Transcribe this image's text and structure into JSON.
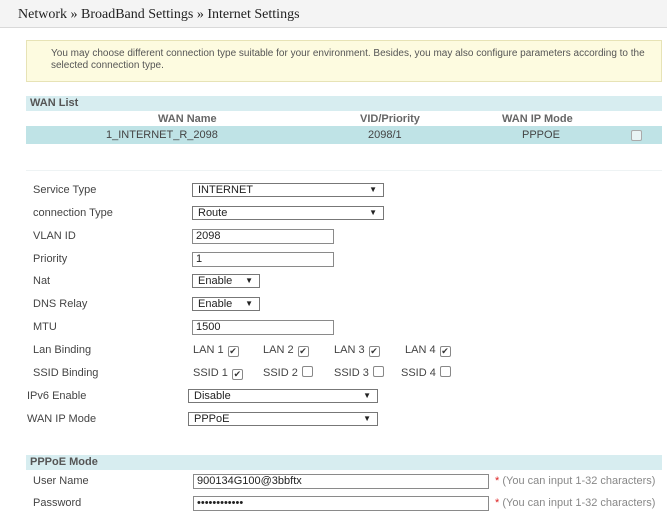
{
  "breadcrumb": "Network » BroadBand Settings » Internet Settings",
  "info_text": "You may choose different connection type suitable for your environment. Besides, you may also configure parameters according to the selected connection type.",
  "wan_list": {
    "title": "WAN List",
    "columns": [
      "WAN Name",
      "VID/Priority",
      "WAN IP Mode"
    ],
    "rows": [
      {
        "name": "1_INTERNET_R_2098",
        "vid_priority": "2098/1",
        "ip_mode": "PPPOE",
        "checked": false
      }
    ]
  },
  "form": {
    "service_type": {
      "label": "Service Type",
      "value": "INTERNET"
    },
    "connection_type": {
      "label": "connection Type",
      "value": "Route"
    },
    "vlan_id": {
      "label": "VLAN ID",
      "value": "2098"
    },
    "priority": {
      "label": "Priority",
      "value": "1"
    },
    "nat": {
      "label": "Nat",
      "value": "Enable"
    },
    "dns_relay": {
      "label": "DNS Relay",
      "value": "Enable"
    },
    "mtu": {
      "label": "MTU",
      "value": "1500"
    },
    "lan_binding": {
      "label": "Lan Binding",
      "items": [
        {
          "label": "LAN 1",
          "checked": true
        },
        {
          "label": "LAN 2",
          "checked": true
        },
        {
          "label": "LAN 3",
          "checked": true
        },
        {
          "label": "LAN 4",
          "checked": true
        }
      ]
    },
    "ssid_binding": {
      "label": "SSID Binding",
      "items": [
        {
          "label": "SSID 1",
          "checked": true
        },
        {
          "label": "SSID 2",
          "checked": false
        },
        {
          "label": "SSID 3",
          "checked": false
        },
        {
          "label": "SSID 4",
          "checked": false
        }
      ]
    },
    "ipv6_enable": {
      "label": "IPv6 Enable",
      "value": "Disable"
    },
    "wan_ip_mode": {
      "label": "WAN IP Mode",
      "value": "PPPoE"
    }
  },
  "pppoe": {
    "title": "PPPoE Mode",
    "user_name": {
      "label": "User Name",
      "value": "900134G100@3bbftx",
      "hint": "(You can input 1-32 characters)"
    },
    "password": {
      "label": "Password",
      "value": "••••••••••••",
      "hint": "(You can input 1-32 characters)"
    }
  },
  "required_mark": "*",
  "check_glyph": "✔",
  "dropdown_icon": "chevron-down-icon",
  "colors": {
    "section_header_bg": "#d7edf0",
    "selected_row_bg": "#bfe3e6",
    "info_bg": "#fdfbe0",
    "required": "#dd2222"
  }
}
